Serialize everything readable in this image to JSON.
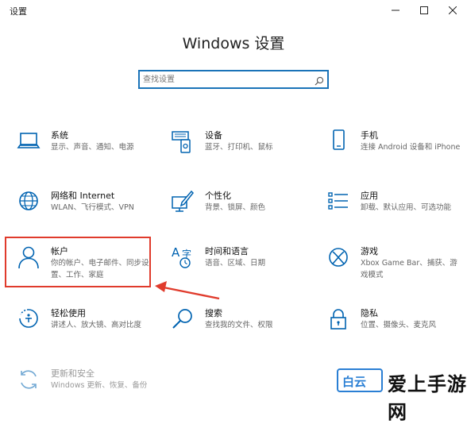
{
  "window": {
    "title": "设置",
    "minimize_icon": "minimize-icon",
    "maximize_icon": "maximize-icon",
    "close_icon": "close-icon"
  },
  "heading": "Windows 设置",
  "search": {
    "placeholder": "查找设置",
    "icon": "search-icon"
  },
  "accent_color": "#0063b1",
  "highlight_color": "#e03b2c",
  "tiles": [
    {
      "title": "系统",
      "desc": "显示、声音、通知、电源",
      "icon": "laptop-icon"
    },
    {
      "title": "设备",
      "desc": "蓝牙、打印机、鼠标",
      "icon": "devices-icon"
    },
    {
      "title": "手机",
      "desc": "连接 Android 设备和 iPhone",
      "icon": "phone-icon"
    },
    {
      "title": "网络和 Internet",
      "desc": "WLAN、飞行模式、VPN",
      "icon": "globe-icon"
    },
    {
      "title": "个性化",
      "desc": "背景、锁屏、颜色",
      "icon": "paintbrush-icon"
    },
    {
      "title": "应用",
      "desc": "卸载、默认应用、可选功能",
      "icon": "apps-list-icon"
    },
    {
      "title": "帐户",
      "desc": "你的帐户、电子邮件、同步设置、工作、家庭",
      "icon": "person-icon"
    },
    {
      "title": "时间和语言",
      "desc": "语音、区域、日期",
      "icon": "time-language-icon"
    },
    {
      "title": "游戏",
      "desc": "Xbox Game Bar、捕获、游戏模式",
      "icon": "xbox-icon"
    },
    {
      "title": "轻松使用",
      "desc": "讲述人、放大镜、高对比度",
      "icon": "ease-of-access-icon"
    },
    {
      "title": "搜索",
      "desc": "查找我的文件、权限",
      "icon": "search-icon"
    },
    {
      "title": "隐私",
      "desc": "位置、摄像头、麦克风",
      "icon": "lock-icon"
    },
    {
      "title": "更新和安全",
      "desc": "Windows 更新、恢复、备份",
      "icon": "refresh-icon"
    }
  ],
  "watermark": {
    "badge": "白云",
    "text": "爱上手游网"
  }
}
